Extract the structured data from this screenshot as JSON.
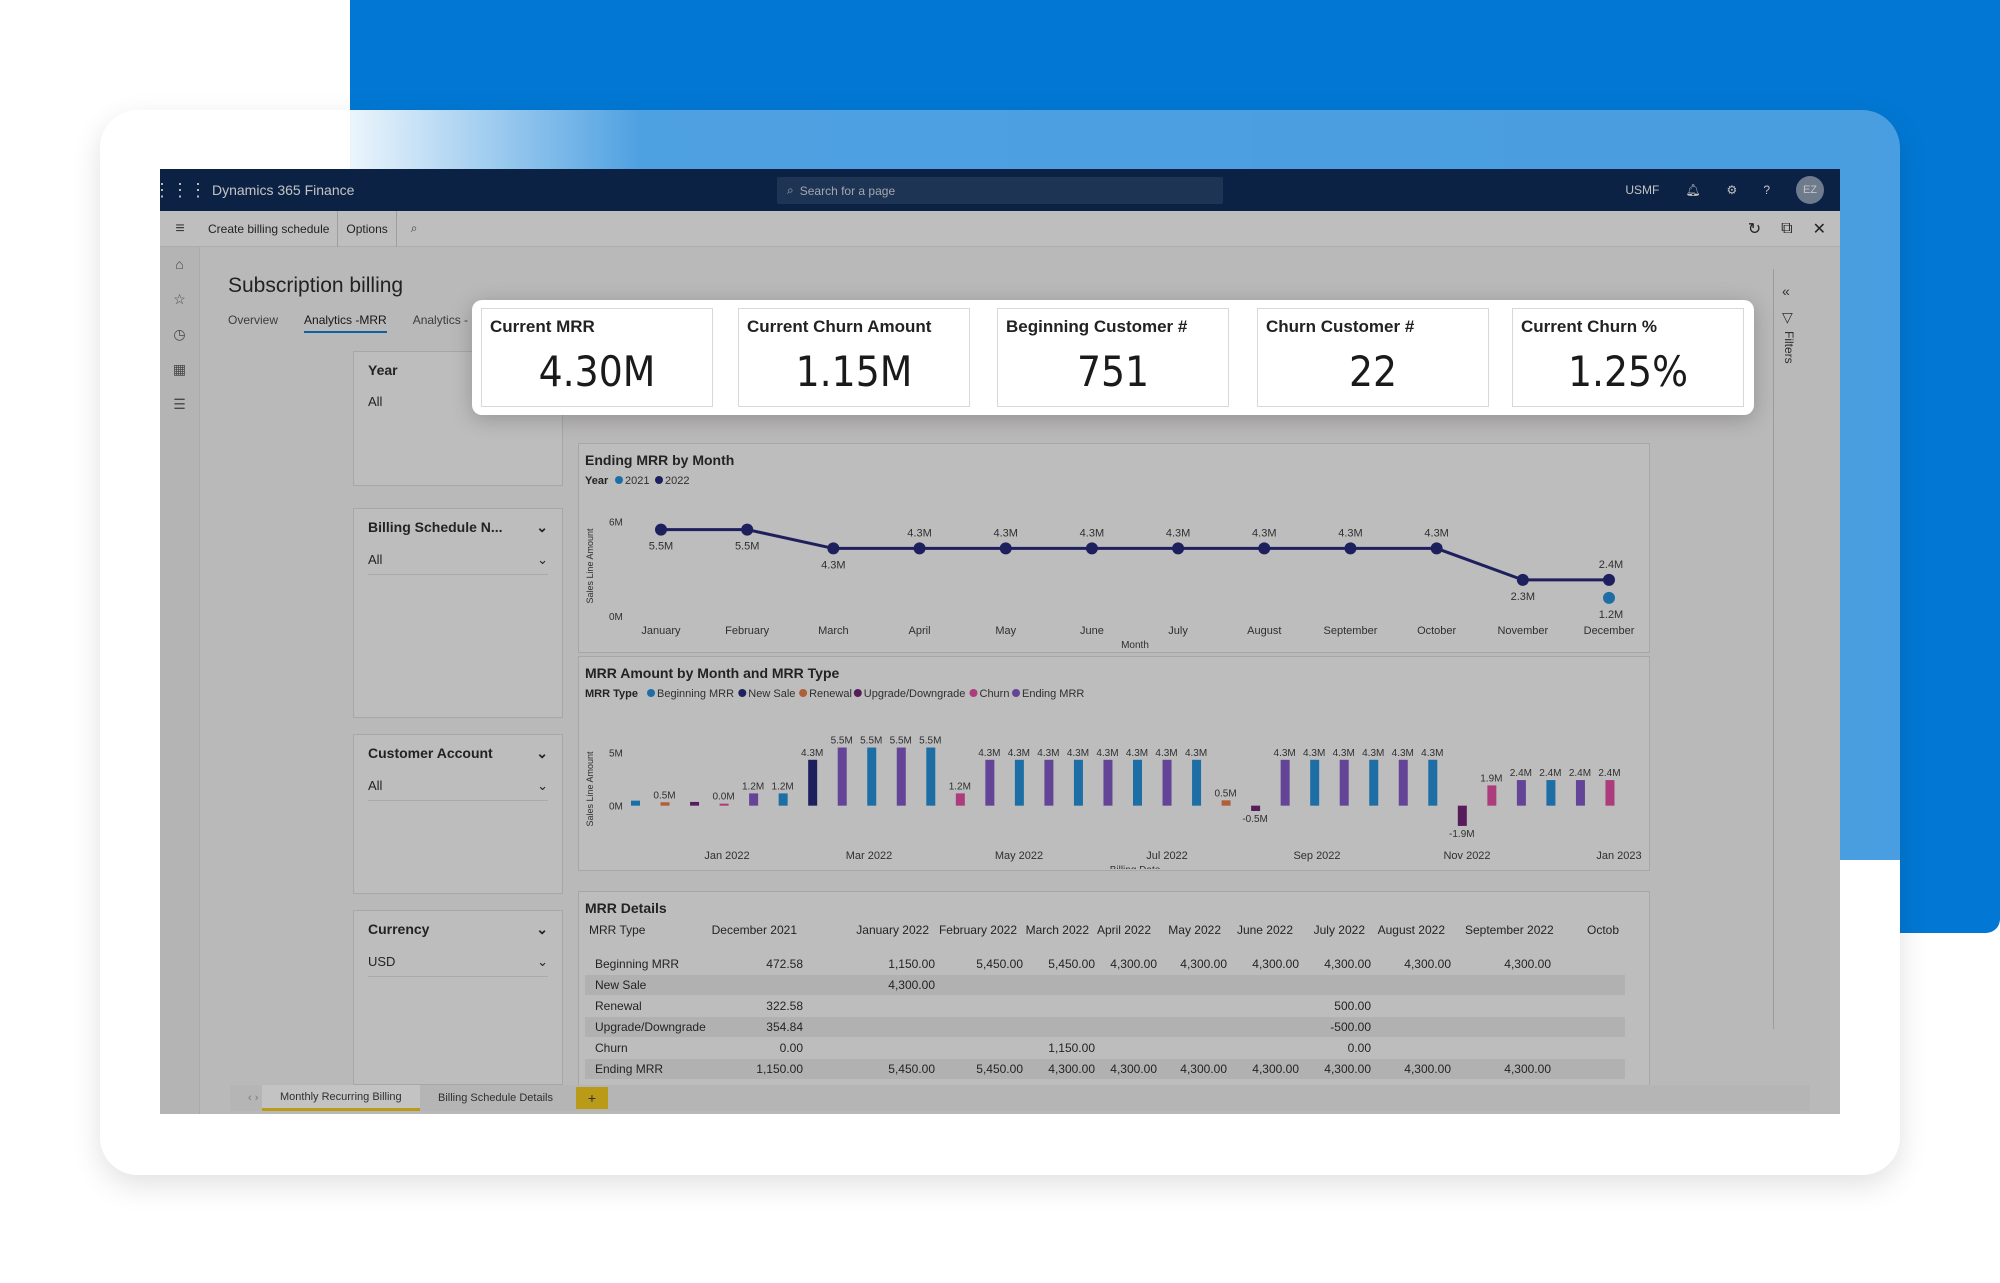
{
  "app": {
    "title": "Dynamics 365 Finance",
    "search_placeholder": "Search for a page",
    "company": "USMF",
    "avatar_initials": "EZ"
  },
  "actionbar": {
    "create_billing_schedule": "Create billing schedule",
    "options": "Options"
  },
  "page": {
    "title": "Subscription billing",
    "tabs": [
      "Overview",
      "Analytics -MRR",
      "Analytics -"
    ]
  },
  "slicers": [
    {
      "title": "Year",
      "value": "All"
    },
    {
      "title": "Billing Schedule N...",
      "value": "All"
    },
    {
      "title": "Customer Account",
      "value": "All"
    },
    {
      "title": "Currency",
      "value": "USD"
    }
  ],
  "kpis": [
    {
      "label": "Current MRR",
      "value": "4.30M"
    },
    {
      "label": "Current Churn Amount",
      "value": "1.15M"
    },
    {
      "label": "Beginning Customer #",
      "value": "751"
    },
    {
      "label": "Churn Customer #",
      "value": "22"
    },
    {
      "label": "Current Churn %",
      "value": "1.25%"
    }
  ],
  "filters_label": "Filters",
  "chart_data": [
    {
      "type": "line",
      "title": "Ending MRR by Month",
      "legend_title": "Year",
      "xlabel": "Month",
      "ylabel": "Sales Line Amount",
      "ytick_labels": [
        "6M",
        "0M"
      ],
      "ylim": [
        0,
        7
      ],
      "categories": [
        "January",
        "February",
        "March",
        "April",
        "May",
        "June",
        "July",
        "August",
        "September",
        "October",
        "November",
        "December"
      ],
      "series": [
        {
          "name": "2022",
          "color": "#1b1d72",
          "values": [
            5.5,
            5.5,
            4.3,
            4.3,
            4.3,
            4.3,
            4.3,
            4.3,
            4.3,
            4.3,
            2.3,
            2.3
          ],
          "labels": [
            "5.5M",
            "5.5M",
            "4.3M",
            "4.3M",
            "4.3M",
            "4.3M",
            "4.3M",
            "4.3M",
            "4.3M",
            "4.3M",
            "2.3M",
            "2.4M"
          ]
        },
        {
          "name": "2021",
          "color": "#1a8ad4",
          "values": [
            null,
            null,
            null,
            null,
            null,
            null,
            null,
            null,
            null,
            null,
            null,
            1.15
          ],
          "labels": [
            null,
            null,
            null,
            null,
            null,
            null,
            null,
            null,
            null,
            null,
            null,
            "1.2M"
          ]
        }
      ]
    },
    {
      "type": "bar",
      "title": "MRR Amount by Month and MRR Type",
      "legend_title": "MRR Type",
      "xlabel": "Billing Date",
      "ylabel": "Sales Line Amount",
      "ytick_labels": [
        "5M",
        "0M"
      ],
      "ylim": [
        -2,
        7
      ],
      "tick_labels": [
        "Jan 2022",
        "Mar 2022",
        "May 2022",
        "Jul 2022",
        "Sep 2022",
        "Nov 2022",
        "Jan 2023"
      ],
      "series": [
        {
          "name": "Beginning MRR",
          "color": "#1a8ad4"
        },
        {
          "name": "New Sale",
          "color": "#1b1d72"
        },
        {
          "name": "Renewal",
          "color": "#e2763f"
        },
        {
          "name": "Upgrade/Downgrade",
          "color": "#6a1a70"
        },
        {
          "name": "Churn",
          "color": "#e0449c"
        },
        {
          "name": "Ending MRR",
          "color": "#7b4fc2"
        }
      ],
      "bars": [
        {
          "s": 0,
          "v": 0.47,
          "l": ""
        },
        {
          "s": 2,
          "v": 0.32,
          "l": "0.5M"
        },
        {
          "s": 3,
          "v": 0.35,
          "l": ""
        },
        {
          "s": 4,
          "v": 0.0,
          "l": "0.0M"
        },
        {
          "s": 5,
          "v": 1.15,
          "l": "1.2M"
        },
        {
          "s": 0,
          "v": 1.15,
          "l": "1.2M"
        },
        {
          "s": 1,
          "v": 4.3,
          "l": "4.3M"
        },
        {
          "s": 5,
          "v": 5.45,
          "l": "5.5M"
        },
        {
          "s": 0,
          "v": 5.45,
          "l": "5.5M"
        },
        {
          "s": 5,
          "v": 5.45,
          "l": "5.5M"
        },
        {
          "s": 0,
          "v": 5.45,
          "l": "5.5M"
        },
        {
          "s": 4,
          "v": 1.15,
          "l": "1.2M"
        },
        {
          "s": 5,
          "v": 4.3,
          "l": "4.3M"
        },
        {
          "s": 0,
          "v": 4.3,
          "l": "4.3M"
        },
        {
          "s": 5,
          "v": 4.3,
          "l": "4.3M"
        },
        {
          "s": 0,
          "v": 4.3,
          "l": "4.3M"
        },
        {
          "s": 5,
          "v": 4.3,
          "l": "4.3M"
        },
        {
          "s": 0,
          "v": 4.3,
          "l": "4.3M"
        },
        {
          "s": 5,
          "v": 4.3,
          "l": "4.3M"
        },
        {
          "s": 0,
          "v": 4.3,
          "l": "4.3M"
        },
        {
          "s": 2,
          "v": 0.5,
          "l": "0.5M"
        },
        {
          "s": 3,
          "v": -0.5,
          "l": "-0.5M"
        },
        {
          "s": 5,
          "v": 4.3,
          "l": "4.3M"
        },
        {
          "s": 0,
          "v": 4.3,
          "l": "4.3M"
        },
        {
          "s": 5,
          "v": 4.3,
          "l": "4.3M"
        },
        {
          "s": 0,
          "v": 4.3,
          "l": "4.3M"
        },
        {
          "s": 5,
          "v": 4.3,
          "l": "4.3M"
        },
        {
          "s": 0,
          "v": 4.3,
          "l": "4.3M"
        },
        {
          "s": 3,
          "v": -1.9,
          "l": "-1.9M"
        },
        {
          "s": 4,
          "v": 1.9,
          "l": "1.9M"
        },
        {
          "s": 5,
          "v": 2.4,
          "l": "2.4M"
        },
        {
          "s": 0,
          "v": 2.4,
          "l": "2.4M"
        },
        {
          "s": 5,
          "v": 2.4,
          "l": "2.4M"
        },
        {
          "s": 4,
          "v": 2.4,
          "l": "2.4M"
        }
      ]
    }
  ],
  "details": {
    "title": "MRR Details",
    "header": [
      "MRR Type",
      "December 2021",
      "January 2022",
      "February 2022",
      "March 2022",
      "April 2022",
      "May 2022",
      "June 2022",
      "July 2022",
      "August 2022",
      "September 2022",
      "Octob"
    ],
    "rows": [
      [
        "Beginning MRR",
        "472.58",
        "1,150.00",
        "5,450.00",
        "5,450.00",
        "4,300.00",
        "4,300.00",
        "4,300.00",
        "4,300.00",
        "4,300.00",
        "4,300.00",
        ""
      ],
      [
        "New Sale",
        "",
        "4,300.00",
        "",
        "",
        "",
        "",
        "",
        "",
        "",
        "",
        ""
      ],
      [
        "Renewal",
        "322.58",
        "",
        "",
        "",
        "",
        "",
        "",
        "500.00",
        "",
        "",
        ""
      ],
      [
        "Upgrade/Downgrade",
        "354.84",
        "",
        "",
        "",
        "",
        "",
        "",
        "-500.00",
        "",
        "",
        ""
      ],
      [
        "Churn",
        "0.00",
        "",
        "",
        "1,150.00",
        "",
        "",
        "",
        "0.00",
        "",
        "",
        ""
      ],
      [
        "Ending MRR",
        "1,150.00",
        "5,450.00",
        "5,450.00",
        "4,300.00",
        "4,300.00",
        "4,300.00",
        "4,300.00",
        "4,300.00",
        "4,300.00",
        "4,300.00",
        ""
      ]
    ]
  },
  "report_tabs": [
    "Monthly Recurring Billing",
    "Billing Schedule Details"
  ],
  "report_add": "+"
}
